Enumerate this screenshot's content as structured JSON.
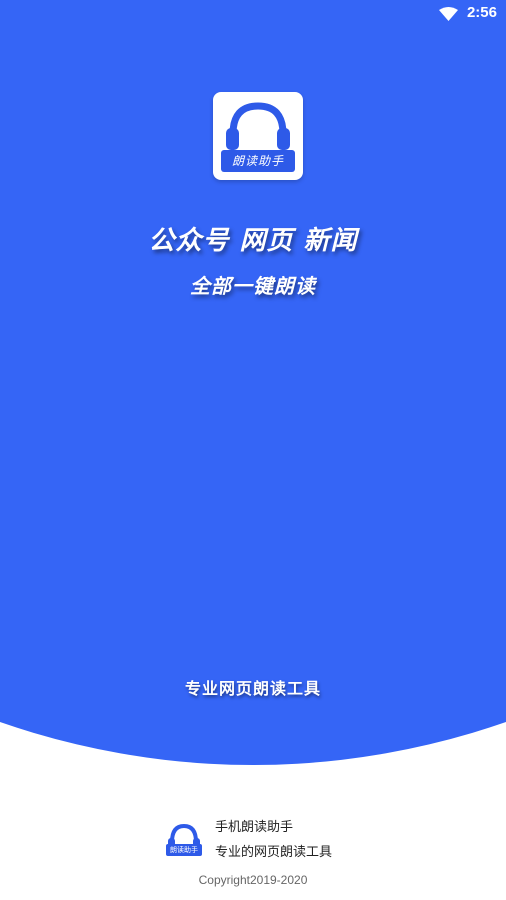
{
  "status_bar": {
    "time": "2:56",
    "icons": [
      "wifi-icon"
    ]
  },
  "colors": {
    "brand_blue": "#3565f6",
    "background": "#ffffff"
  },
  "logo": {
    "label": "朗读助手",
    "icon": "headphones-icon"
  },
  "splash": {
    "headline": "公众号 网页 新闻",
    "subheadline": "全部一键朗读",
    "tagline": "专业网页朗读工具"
  },
  "footer": {
    "logo_label": "朗读助手",
    "app_name": "手机朗读助手",
    "description": "专业的网页朗读工具",
    "copyright": "Copyright2019-2020"
  }
}
